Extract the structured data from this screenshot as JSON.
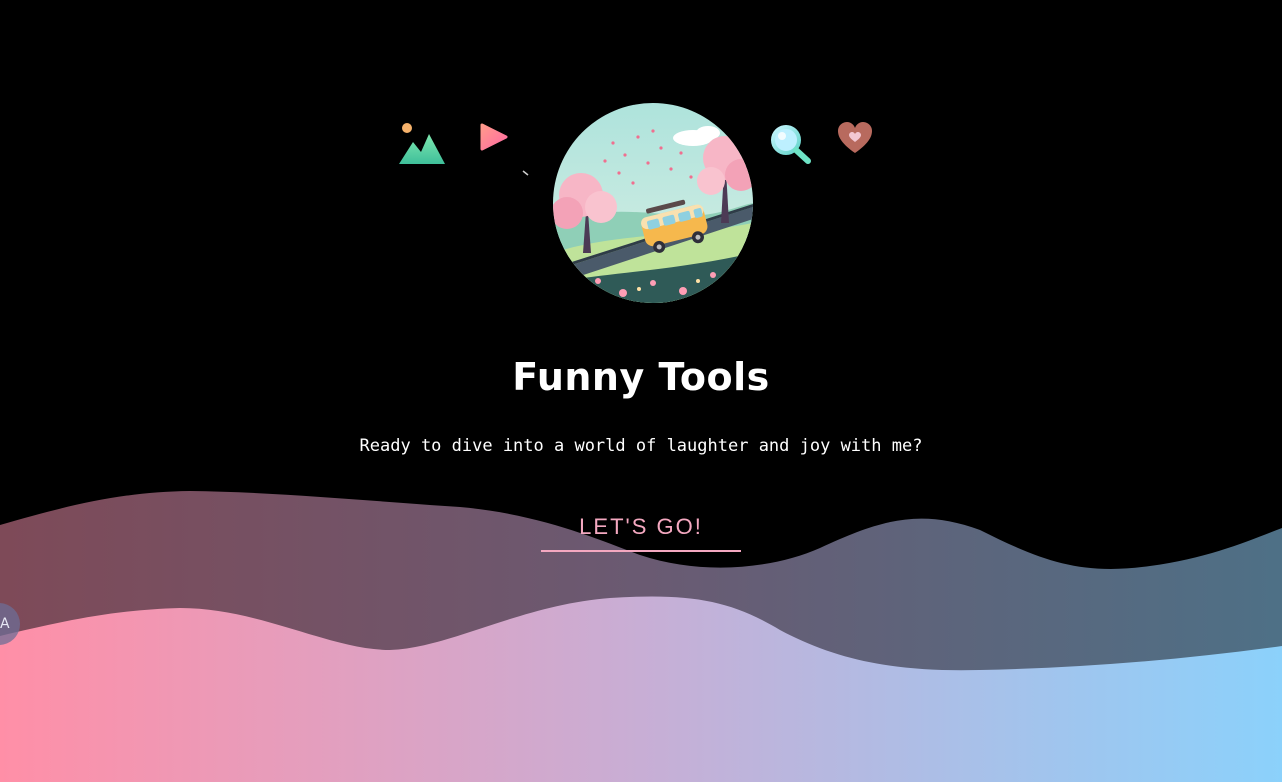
{
  "hero": {
    "title": "Funny Tools",
    "tagline": "Ready to dive into a world of laughter and joy with me?",
    "cta_label": "LET'S GO!"
  },
  "floating_icons": [
    "mountain-image-icon",
    "play-icon",
    "search-icon",
    "heart-icon"
  ],
  "avatar": "camper-van-illustration",
  "side_badge": {
    "icon": "translate-icon",
    "glyph": "A"
  },
  "colors": {
    "background": "#000000",
    "accent_pink": "#f4a8c0",
    "wave_back_left": "#7e4a58",
    "wave_back_right": "#4e7086",
    "wave_front_left": "#ff8fa7",
    "wave_front_mid": "#c8aed5",
    "wave_front_right": "#8bd1fb"
  }
}
